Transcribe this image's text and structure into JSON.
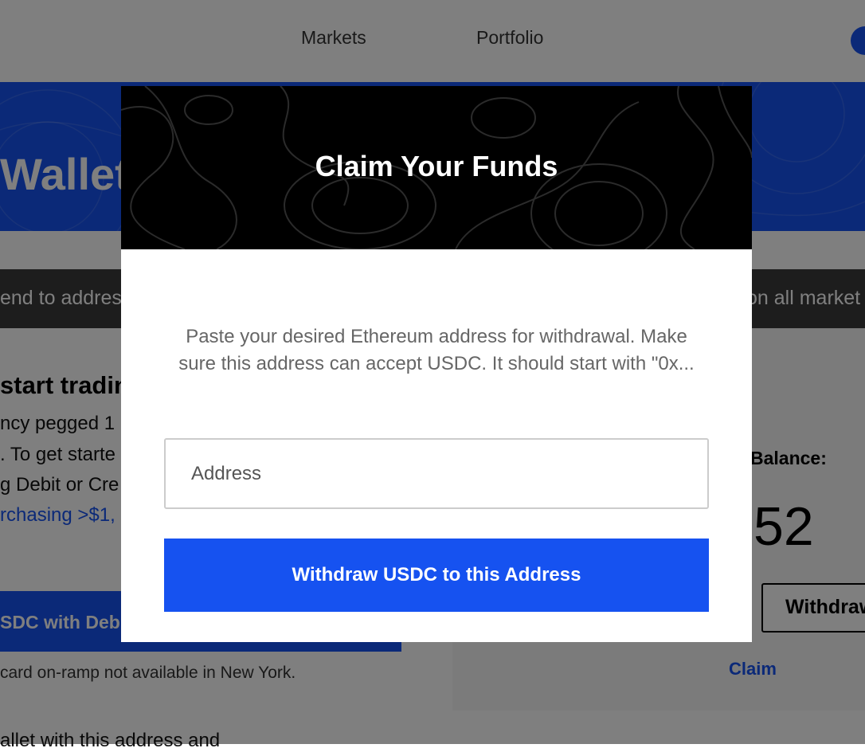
{
  "nav": {
    "markets": "Markets",
    "portfolio": "Portfolio"
  },
  "hero": {
    "title": "Wallet"
  },
  "ticker": {
    "left_text": "end to addres",
    "right_text": "on all market"
  },
  "content": {
    "heading": "start tradin",
    "line1": "ncy pegged 1",
    "line2": ". To get starte",
    "line3": "g Debit or Cre",
    "link_text": "rchasing >$1,",
    "debit_button": "SDC with Debi",
    "ny_note": "card on-ramp not available in New York.",
    "bottom_text": "allet with this address and"
  },
  "balance": {
    "label": "Balance:",
    "value": "52",
    "withdraw_label": "Withdraw",
    "claim_label": "Claim"
  },
  "modal": {
    "title": "Claim Your Funds",
    "description": "Paste your desired Ethereum address for withdrawal. Make sure this address can accept USDC. It should start with \"0x...",
    "address_placeholder": "Address",
    "address_value": "",
    "submit_label": "Withdraw USDC to this Address"
  },
  "colors": {
    "brand_blue": "#1652f0",
    "modal_header_bg": "#000000",
    "overlay": "rgba(0,0,0,0.5)"
  }
}
